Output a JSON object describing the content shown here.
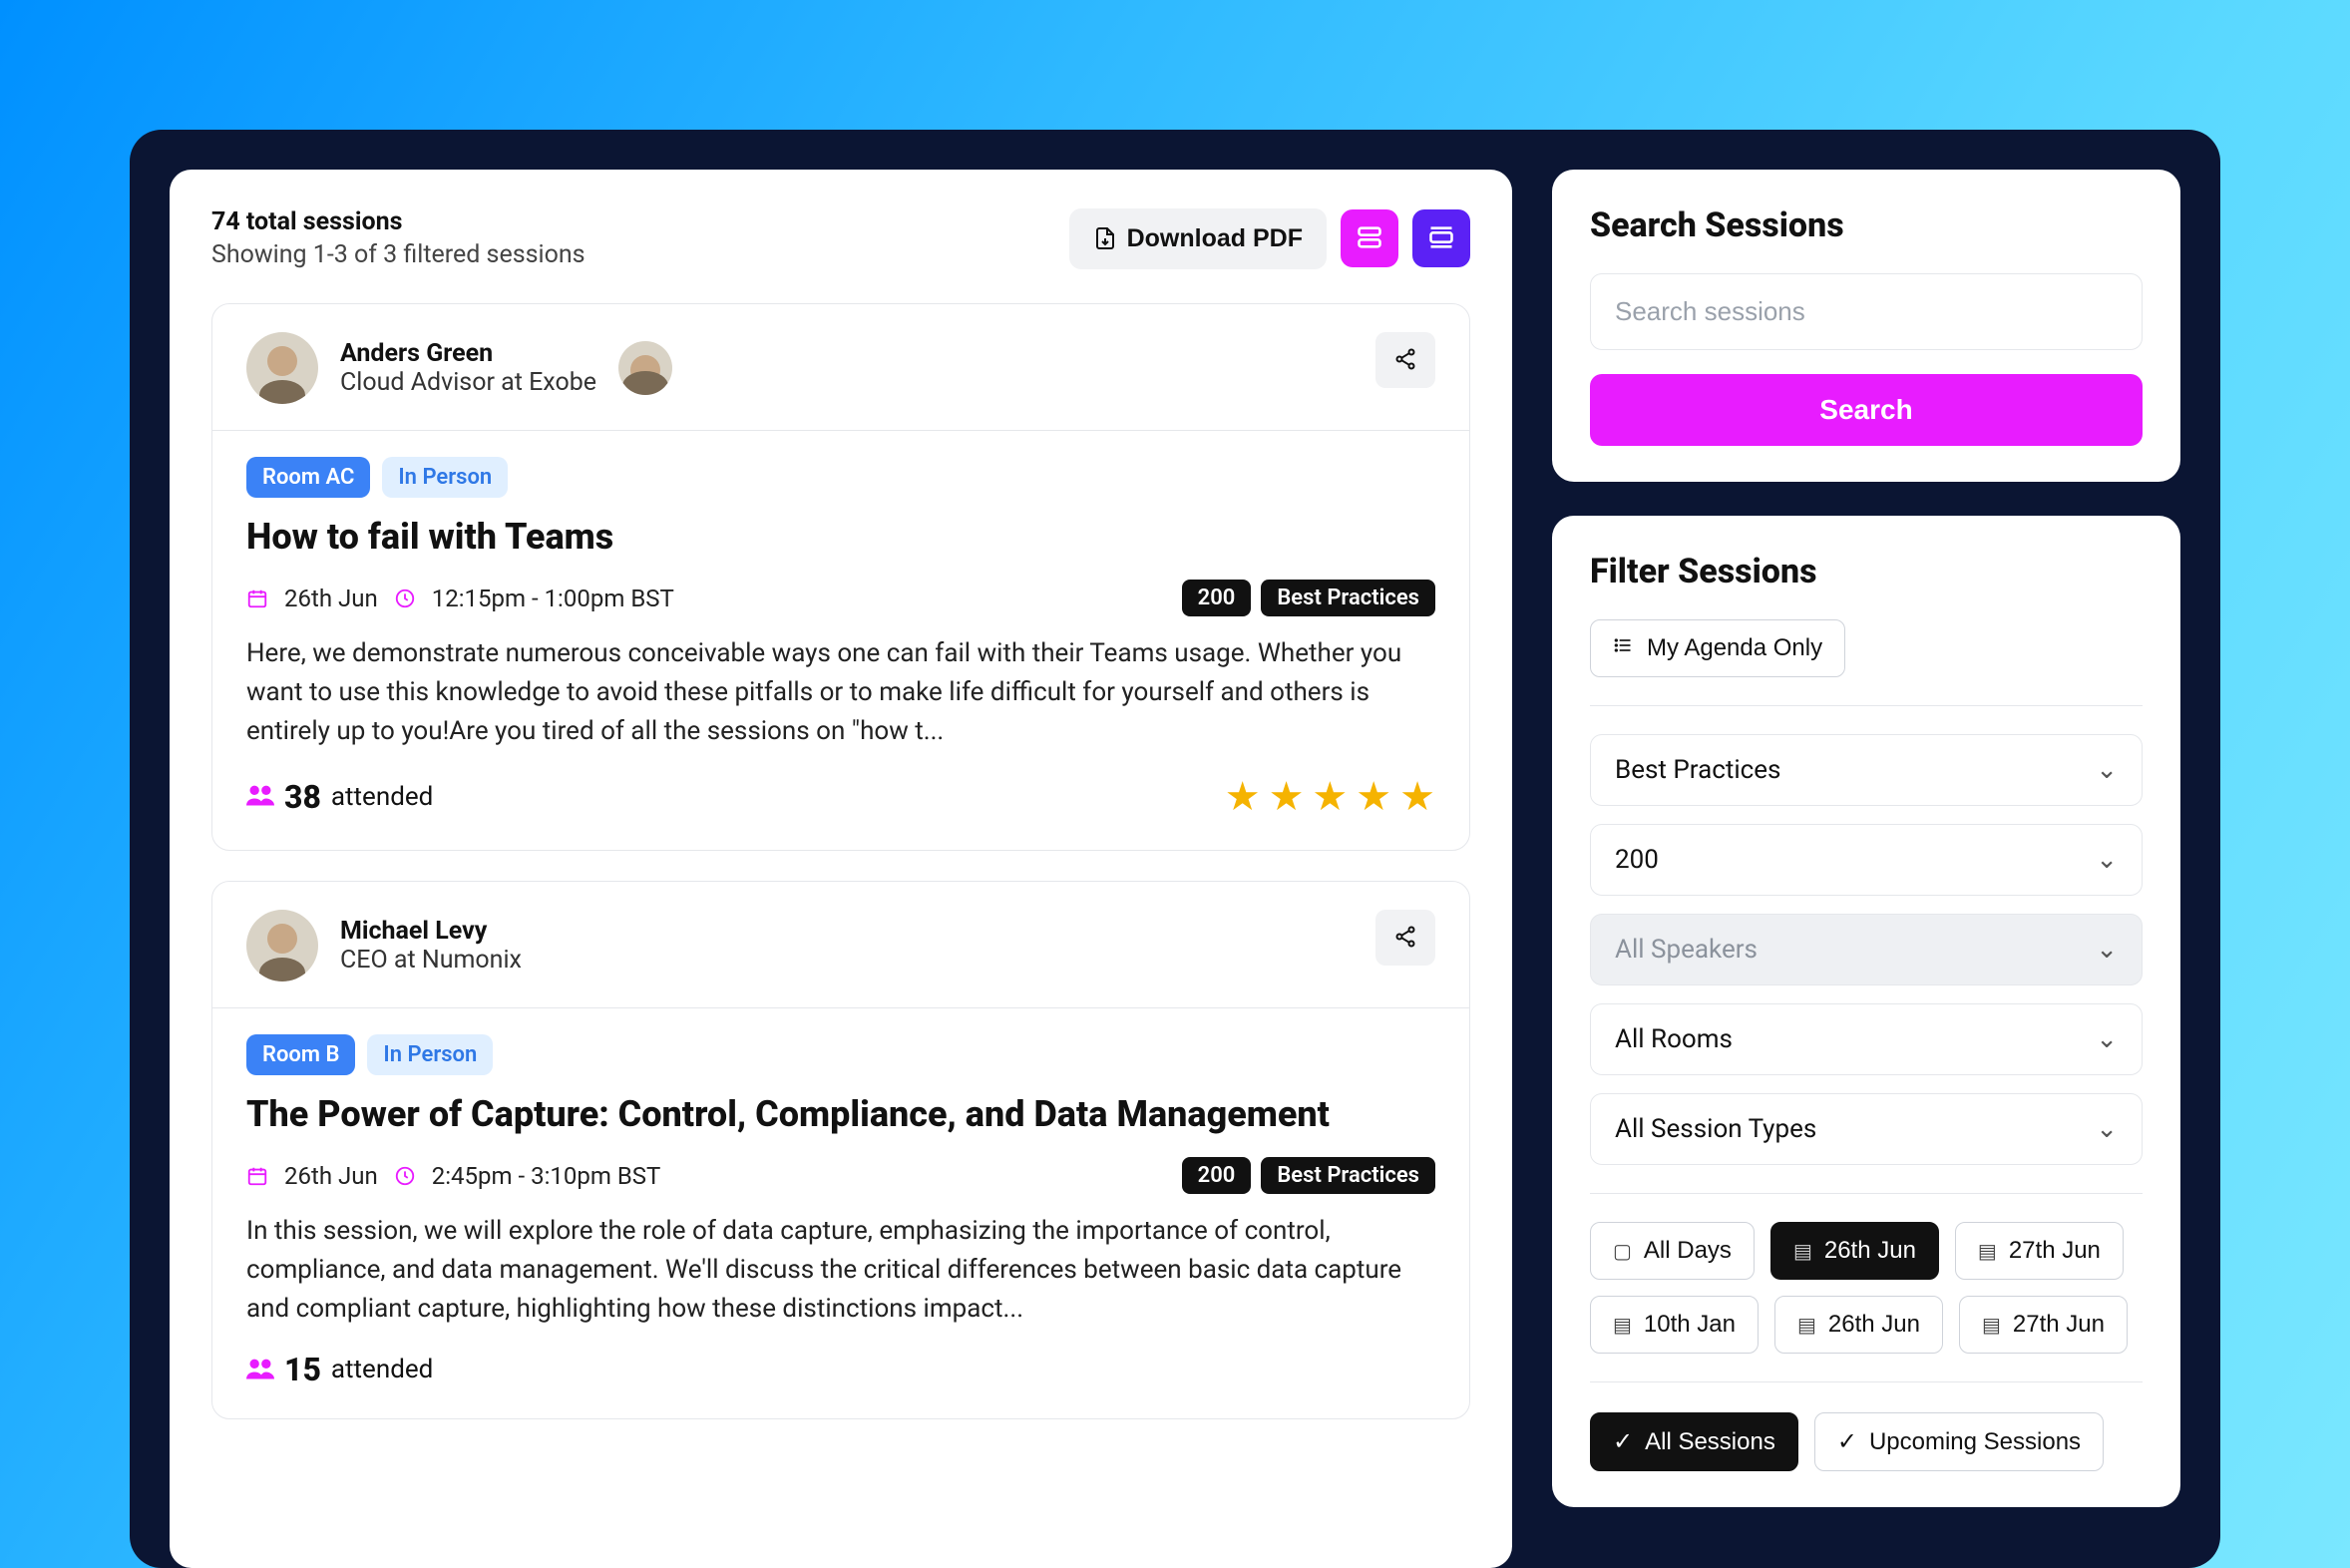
{
  "header": {
    "total_sessions": "74 total sessions",
    "showing": "Showing 1-3 of 3 filtered sessions",
    "download_label": "Download PDF"
  },
  "sessions": [
    {
      "speaker_name": "Anders Green",
      "speaker_role": "Cloud Advisor at Exobe",
      "room": "Room AC",
      "mode": "In Person",
      "title": "How to fail with Teams",
      "date": "26th Jun",
      "time": "12:15pm - 1:00pm BST",
      "level": "200",
      "track": "Best Practices",
      "description": "Here, we demonstrate numerous conceivable ways one can fail with their Teams usage. Whether you want to use this knowledge to avoid these pitfalls or to make life difficult for yourself and others is entirely up to you!Are you tired of all the sessions on \"how t...",
      "attended_count": "38",
      "attended_label": "attended",
      "rating": 5
    },
    {
      "speaker_name": "Michael Levy",
      "speaker_role": "CEO at Numonix",
      "room": "Room B",
      "mode": "In Person",
      "title": "The Power of Capture: Control, Compliance, and Data Management",
      "date": "26th Jun",
      "time": "2:45pm - 3:10pm BST",
      "level": "200",
      "track": "Best Practices",
      "description": "In this session, we will explore the role of data capture, emphasizing the importance of control, compliance, and data management. We'll discuss the critical differences between basic data capture and compliant capture, highlighting how these distinctions impact...",
      "attended_count": "15",
      "attended_label": "attended",
      "rating": 0
    }
  ],
  "search": {
    "title": "Search Sessions",
    "placeholder": "Search sessions",
    "button": "Search"
  },
  "filters": {
    "title": "Filter Sessions",
    "my_agenda": "My Agenda Only",
    "track_value": "Best Practices",
    "level_value": "200",
    "speakers_value": "All Speakers",
    "rooms_value": "All Rooms",
    "types_value": "All Session Types",
    "days": [
      {
        "label": "All Days",
        "active": false
      },
      {
        "label": "26th Jun",
        "active": true
      },
      {
        "label": "27th Jun",
        "active": false
      },
      {
        "label": "10th Jan",
        "active": false
      },
      {
        "label": "26th Jun",
        "active": false
      },
      {
        "label": "27th Jun",
        "active": false
      }
    ],
    "segment": {
      "all": "All Sessions",
      "upcoming": "Upcoming Sessions"
    }
  }
}
